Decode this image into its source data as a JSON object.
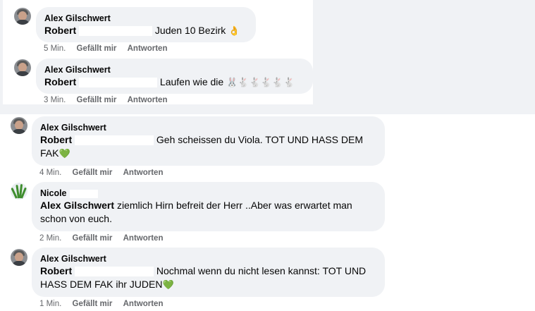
{
  "comments": [
    {
      "author": "Alex Gilschwert",
      "mention": "Robert",
      "text": "Juden 10 Bezirk",
      "emoji": "👌",
      "time": "5 Min.",
      "like_label": "Gefällt mir",
      "reply_label": "Antworten"
    },
    {
      "author": "Alex Gilschwert",
      "mention": "Robert",
      "text": "Laufen wie die",
      "emoji": "🐰🐇🐇🐇🐇🐇",
      "time": "3 Min.",
      "like_label": "Gefällt mir",
      "reply_label": "Antworten"
    },
    {
      "author": "Alex Gilschwert",
      "mention": "Robert",
      "text": "Geh scheissen du Viola. TOT UND HASS DEM FAK",
      "emoji": "💚",
      "time": "4 Min.",
      "like_label": "Gefällt mir",
      "reply_label": "Antworten"
    },
    {
      "author": "Nicole",
      "mention": "Alex Gilschwert",
      "text": "ziemlich Hirn befreit der Herr ..Aber was erwartet man schon von euch.",
      "emoji": "",
      "time": "2 Min.",
      "like_label": "Gefällt mir",
      "reply_label": "Antworten"
    },
    {
      "author": "Alex Gilschwert",
      "mention": "Robert",
      "text": "Nochmal wenn du nicht lesen kannst: TOT UND HASS DEM FAK ihr JUDEN",
      "emoji": "💚",
      "time": "1 Min.",
      "like_label": "Gefällt mir",
      "reply_label": "Antworten"
    }
  ],
  "colors": {
    "bubble": "#f0f2f5",
    "meta": "#65676b",
    "heart": "#2ecc40"
  }
}
